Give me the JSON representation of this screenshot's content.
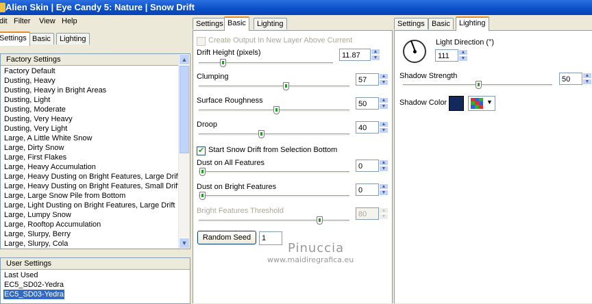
{
  "window": {
    "title": "Alien Skin | Eye Candy 5: Nature | Snow Drift"
  },
  "menu": [
    "dit",
    "Filter",
    "View",
    "Help"
  ],
  "left_tabs": [
    "Settings",
    "Basic",
    "Lighting"
  ],
  "factory_settings": {
    "header": "Factory Settings",
    "items": [
      "Factory Default",
      "Dusting, Heavy",
      "Dusting, Heavy in Bright Areas",
      "Dusting, Light",
      "Dusting, Moderate",
      "Dusting, Very Heavy",
      "Dusting, Very Light",
      "Large, A Little White Snow",
      "Large, Dirty Snow",
      "Large, First Flakes",
      "Large, Heavy Accumulation",
      "Large, Heavy Dusting on Bright Features, Large Drift",
      "Large, Heavy Dusting on Bright Features, Small Drift",
      "Large, Large Snow Pile from Bottom",
      "Large, Light Dusting on Bright Features, Large Drift",
      "Large, Lumpy Snow",
      "Large, Rooftop Accumulation",
      "Large, Slurpy, Berry",
      "Large, Slurpy, Cola"
    ]
  },
  "user_settings": {
    "header": "User Settings",
    "items": [
      "Last Used",
      "EC5_SD02-Yedra",
      "EC5_SD03-Yedra"
    ],
    "selected": "EC5_SD03-Yedra"
  },
  "basic_tab": {
    "tabs": [
      "Settings",
      "Basic",
      "Lighting"
    ],
    "create_output_label": "Create Output In New Layer Above Current",
    "drift_height": {
      "label": "Drift Height (pixels)",
      "value": "11.87"
    },
    "clumping": {
      "label": "Clumping",
      "value": "57"
    },
    "surface_roughness": {
      "label": "Surface Roughness",
      "value": "50"
    },
    "droop": {
      "label": "Droop",
      "value": "40"
    },
    "start_from_selection_label": "Start Snow Drift from Selection Bottom",
    "dust_all": {
      "label": "Dust on All Features",
      "value": "0"
    },
    "dust_bright": {
      "label": "Dust on Bright Features",
      "value": "0"
    },
    "bright_threshold": {
      "label": "Bright Features Threshold",
      "value": "80"
    },
    "random_seed_label": "Random Seed",
    "random_seed_value": "1"
  },
  "lighting_tab": {
    "tabs": [
      "Settings",
      "Basic",
      "Lighting"
    ],
    "light_direction": {
      "label": "Light Direction (°)",
      "value": "111"
    },
    "shadow_strength": {
      "label": "Shadow Strength",
      "value": "50"
    },
    "shadow_color": {
      "label": "Shadow Color",
      "swatch": "#13295c"
    }
  },
  "watermark": {
    "name": "Pinuccia",
    "url": "www.maidiregrafica.eu"
  }
}
